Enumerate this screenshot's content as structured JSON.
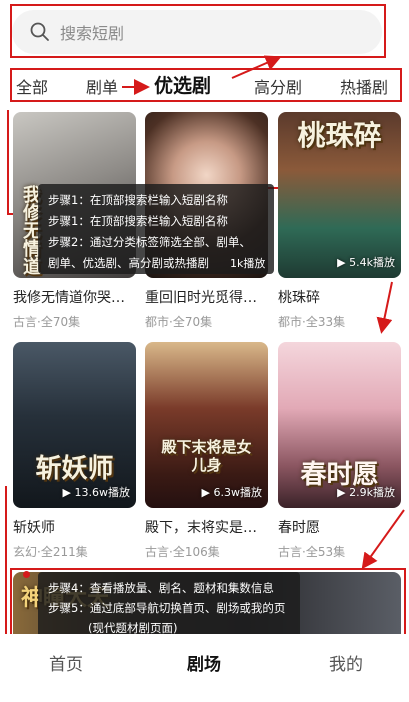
{
  "search": {
    "placeholder": "搜索短剧"
  },
  "tabs": [
    {
      "label": "全部"
    },
    {
      "label": "剧单"
    },
    {
      "label": "优选剧"
    },
    {
      "label": "高分剧"
    },
    {
      "label": "热播剧"
    }
  ],
  "cards": [
    {
      "title": "我修无情道你哭…",
      "meta": "古言·全70集",
      "plays": "",
      "poster_text": "我修无情道"
    },
    {
      "title": "重回旧时光觅得…",
      "meta": "都市·全70集",
      "plays": "",
      "poster_text": ""
    },
    {
      "title": "桃珠碎",
      "meta": "都市·全33集",
      "plays": "5.4k播放",
      "poster_text": "桃珠碎"
    },
    {
      "title": "斩妖师",
      "meta": "玄幻·全211集",
      "plays": "13.6w播放",
      "poster_text": "斩妖师"
    },
    {
      "title": "殿下，末将实是…",
      "meta": "古言·全106集",
      "plays": "6.3w播放",
      "poster_text": "殿下末将是女儿身"
    },
    {
      "title": "春时愿",
      "meta": "古言·全53集",
      "plays": "2.9k播放",
      "poster_text": "春时愿"
    }
  ],
  "banner": {
    "poster_text": "神瞳大天"
  },
  "steps_top": [
    "步骤1：在顶部搜索栏输入短剧名称",
    "步骤1：在顶部搜索栏输入短剧名称",
    "步骤2：通过分类标签筛选全部、剧单、",
    "剧单、优选剧、高分剧或热播剧"
  ],
  "steps_bottom": [
    "步骤4：查看播放量、剧名、题材和集数信息",
    "步骤5：通过底部导航切换首页、剧场或我的页",
    "(现代题材剧页面)"
  ],
  "play_hidden": "1k播放",
  "nav": [
    {
      "label": "首页"
    },
    {
      "label": "剧场"
    },
    {
      "label": "我的"
    }
  ],
  "colors": {
    "annotation": "#d51a1a",
    "active_text": "#111111",
    "muted": "#999999"
  }
}
